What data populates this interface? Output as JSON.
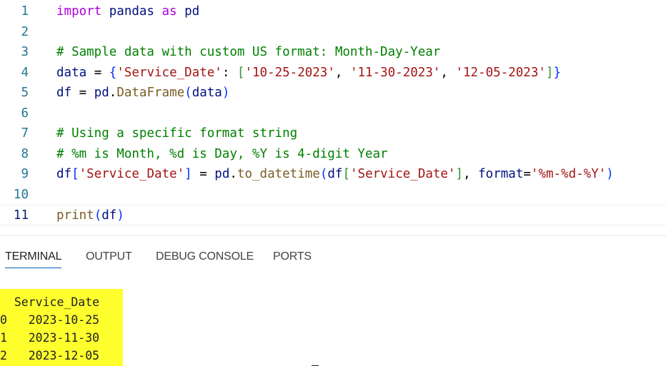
{
  "editor": {
    "lines": [
      {
        "num": "1",
        "tokens": [
          "import",
          " pandas ",
          "as",
          " pd"
        ]
      },
      {
        "num": "2"
      },
      {
        "num": "3",
        "tokens": [
          "# Sample data with custom US format: Month-Day-Year"
        ]
      },
      {
        "num": "4",
        "tokens": [
          "data",
          " = ",
          "{",
          "'Service_Date'",
          ": ",
          "[",
          "'10-25-2023'",
          ", ",
          "'11-30-2023'",
          ", ",
          "'12-05-2023'",
          "]",
          "}"
        ]
      },
      {
        "num": "5",
        "tokens": [
          "df",
          " = ",
          "pd",
          ".",
          "DataFrame",
          "(",
          "data",
          ")"
        ]
      },
      {
        "num": "6"
      },
      {
        "num": "7",
        "tokens": [
          "# Using a specific format string"
        ]
      },
      {
        "num": "8",
        "tokens": [
          "# %m is Month, %d is Day, %Y is 4-digit Year"
        ]
      },
      {
        "num": "9",
        "tokens": [
          "df",
          "[",
          "'Service_Date'",
          "]",
          " = ",
          "pd",
          ".",
          "to_datetime",
          "(",
          "df",
          "[",
          "'Service_Date'",
          "]",
          ", ",
          "format",
          "=",
          "'%m-%d-%Y'",
          ")"
        ]
      },
      {
        "num": "10"
      },
      {
        "num": "11",
        "tokens": [
          "print",
          "(",
          "df",
          ")"
        ]
      }
    ]
  },
  "panel": {
    "tabs": [
      {
        "label": "TERMINAL"
      },
      {
        "label": "OUTPUT"
      },
      {
        "label": "DEBUG CONSOLE"
      },
      {
        "label": "PORTS"
      }
    ],
    "terminal_output": {
      "header": "  Service_Date",
      "rows": [
        "0   2023-10-25",
        "1   2023-11-30",
        "2   2023-12-05"
      ]
    }
  },
  "colors": {
    "keyword": "#af00db",
    "function": "#795e26",
    "variable": "#001080",
    "string": "#a31515",
    "comment": "#008000",
    "bracket_level1": "#0431fa",
    "bracket_level2": "#319331",
    "line_number": "#237893",
    "highlight": "#ffff2e",
    "active_tab_underline": "#005fb8"
  }
}
